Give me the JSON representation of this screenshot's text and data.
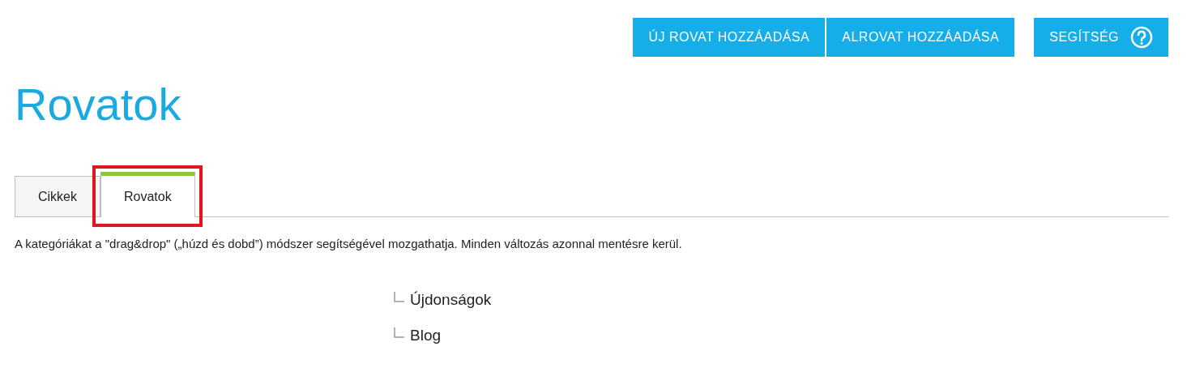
{
  "toolbar": {
    "buttons": [
      {
        "label": "ÚJ ROVAT HOZZÁADÁSA",
        "kind": "text"
      },
      {
        "label": "ALROVAT HOZZÁADÁSA",
        "kind": "text"
      },
      {
        "label": "SEGÍTSÉG",
        "kind": "help"
      }
    ]
  },
  "title": "Rovatok",
  "tabs": [
    {
      "label": "Cikkek",
      "selected": false,
      "highlighted": false
    },
    {
      "label": "Rovatok",
      "selected": true,
      "highlighted": true
    }
  ],
  "description": "A kategóriákat a \"drag&drop\" („húzd és dobd”) módszer segítségével mozgathatja. Minden változás azonnal mentésre kerül.",
  "tree": [
    {
      "label": "Újdonságok"
    },
    {
      "label": "Blog"
    }
  ]
}
